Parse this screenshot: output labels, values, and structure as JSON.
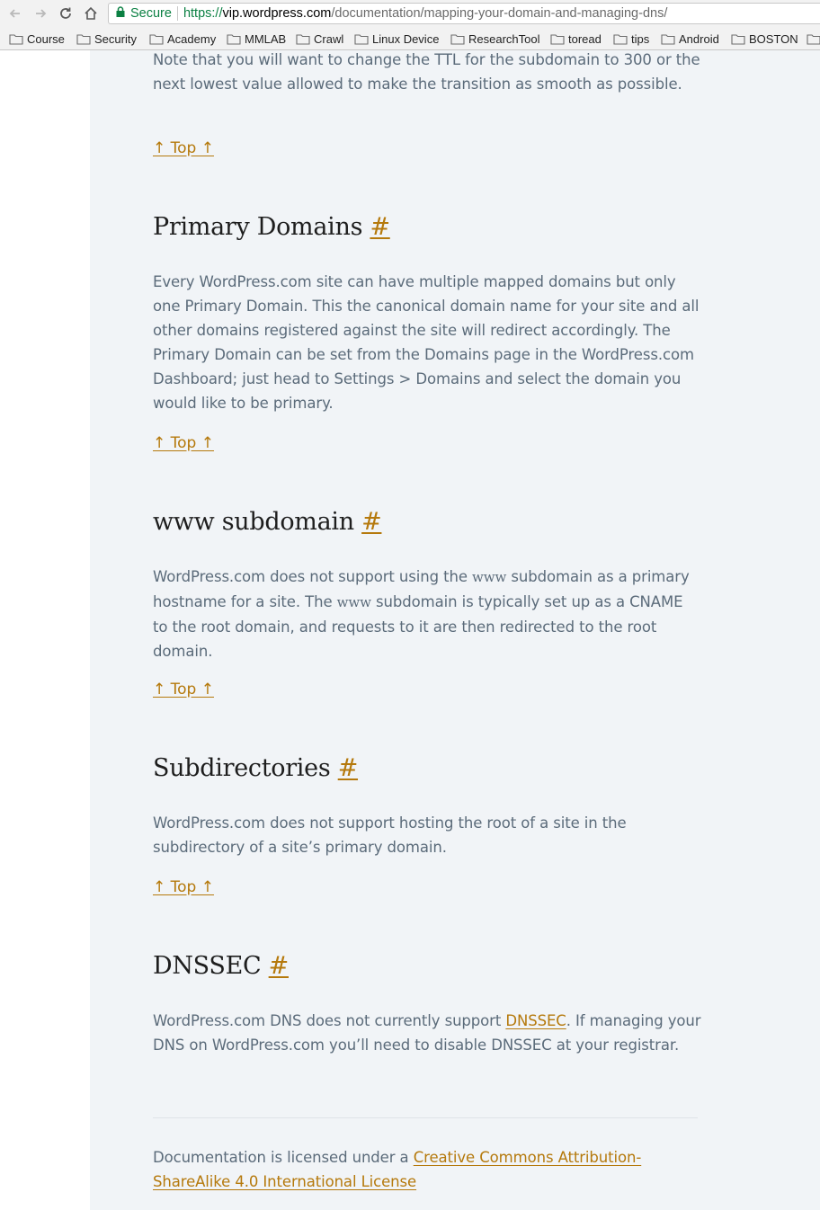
{
  "browser": {
    "secure_label": "Secure",
    "url_scheme": "https://",
    "url_host": "vip.wordpress.com",
    "url_path": "/documentation/mapping-your-domain-and-managing-dns/",
    "bookmarks": [
      "Course",
      "Security",
      "Academy",
      "MMLAB",
      "Crawl",
      "Linux Device",
      "ResearchTool",
      "toread",
      "tips",
      "Android",
      "BOSTON"
    ]
  },
  "article": {
    "intro_paragraph": "Note that you will want to change the TTL for the subdomain to 300 or the next lowest value allowed to make the transition as smooth as possible.",
    "top_link_label": "↑ Top ↑",
    "anchor_symbol": "#",
    "sections": [
      {
        "heading": "Primary Domains",
        "body": "Every WordPress.com site can have multiple mapped domains but only one Primary Domain. This the canonical domain name for your site and all other domains registered against the site will redirect accordingly. The Primary Domain can be set from the Domains page in the WordPress.com Dashboard; just head to Settings > Domains and select the domain you would like to be primary."
      },
      {
        "heading": "www subdomain",
        "body_parts": [
          "WordPress.com does not support using the ",
          "www",
          " subdomain as a primary hostname for a site. The ",
          "www",
          " subdomain is typically set up as a CNAME to the root domain, and requests to it are then redirected to the root domain."
        ]
      },
      {
        "heading": "Subdirectories",
        "body": "WordPress.com does not support hosting the root of a site in the subdirectory of a site’s primary domain."
      },
      {
        "heading": "DNSSEC",
        "body_before": "WordPress.com DNS does not currently support ",
        "body_link": "DNSSEC",
        "body_after": ". If managing your DNS on WordPress.com you’ll need to disable DNSSEC at your registrar."
      }
    ],
    "footer_text": "Documentation is licensed under a ",
    "footer_link": "Creative Commons Attribution-ShareAlike 4.0 International License"
  },
  "colors": {
    "link": "#b5790c",
    "body_text": "#5b6b7a",
    "heading": "#1e1e1e",
    "content_bg": "#f1f4f7",
    "secure_green": "#0b8043"
  }
}
